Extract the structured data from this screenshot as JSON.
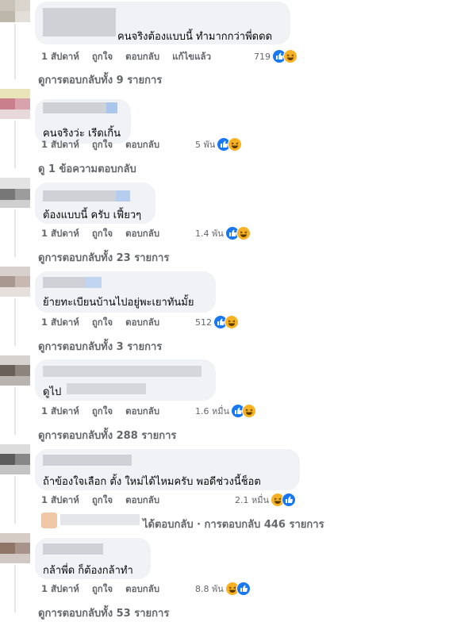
{
  "comments": [
    {
      "text": "คนจริงต้องแบบนี้ ทำมากกว่าพี่ดดด",
      "time": "1 สัปดาห์",
      "like": "ถูกใจ",
      "reply": "ตอบกลับ",
      "edited": "แก้ไขแล้ว",
      "count": "719",
      "replies": "ดูการตอบกลับทั้ง 9 รายการ"
    },
    {
      "text": "คนจริงว่ะ เรีดเกิ้น",
      "time": "1 สัปดาห์",
      "like": "ถูกใจ",
      "reply": "ตอบกลับ",
      "count": "5 พัน",
      "replies": "ดู 1 ข้อความตอบกลับ"
    },
    {
      "text": "ต้องแบบนี้ ครับ เฟี้ยวๆ",
      "time": "1 สัปดาห์",
      "like": "ถูกใจ",
      "reply": "ตอบกลับ",
      "count": "1.4 พัน",
      "replies": "ดูการตอบกลับทั้ง 23 รายการ"
    },
    {
      "text": "ย้ายทะเบียนบ้านไปอยู่พะเยาทันมั้ย",
      "time": "1 สัปดาห์",
      "like": "ถูกใจ",
      "reply": "ตอบกลับ",
      "count": "512",
      "replies": "ดูการตอบกลับทั้ง 3 รายการ"
    },
    {
      "text": "ดูไป",
      "time": "1 สัปดาห์",
      "like": "ถูกใจ",
      "reply": "ตอบกลับ",
      "count": "1.6 หมื่น",
      "replies": "ดูการตอบกลับทั้ง 288 รายการ"
    },
    {
      "text": "ถ้าข้องใจเลือก ตั้ง ใหม่ได้ไหมครับ พอดีช่วงนี้ช็อต",
      "time": "1 สัปดาห์",
      "like": "ถูกใจ",
      "reply": "ตอบกลับ",
      "count": "2.1 หมื่น",
      "replies": "ได้ตอบกลับ · การตอบกลับ 446 รายการ"
    },
    {
      "text": "กล้าพี่ด ก็ต้องกล้าทำ",
      "time": "1 สัปดาห์",
      "like": "ถูกใจ",
      "reply": "ตอบกลับ",
      "count": "8.8 พัน",
      "replies": "ดูการตอบกลับทั้ง 53 รายการ"
    }
  ],
  "colors": {
    "like": "#1877f2",
    "haha": "#f7b125",
    "bubble": "#f0f2f5",
    "meta": "#65676b"
  }
}
